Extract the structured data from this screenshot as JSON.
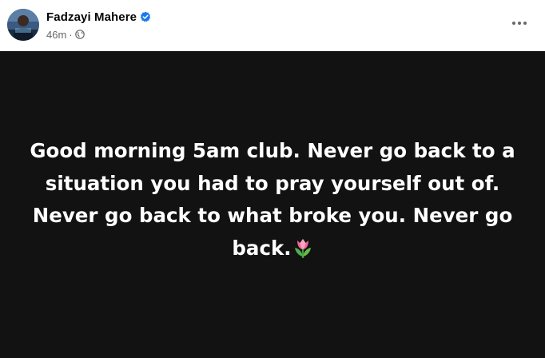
{
  "post": {
    "author": {
      "name": "Fadzayi Mahere",
      "verified_icon": "verified-badge-icon",
      "avatar_icon": "profile-avatar"
    },
    "meta": {
      "timestamp": "46m",
      "separator": "·",
      "audience_icon": "globe-icon"
    },
    "menu_icon": "more-options-icon",
    "body": {
      "text": "Good morning 5am club. Never go back to a situation you had to pray yourself out of. Never go back to what broke you. Never go back.",
      "emoji": "tulip-emoji",
      "background_color": "#121212",
      "text_color": "#ffffff"
    }
  },
  "colors": {
    "verified": "#1877f2",
    "secondary_text": "#65676b"
  }
}
